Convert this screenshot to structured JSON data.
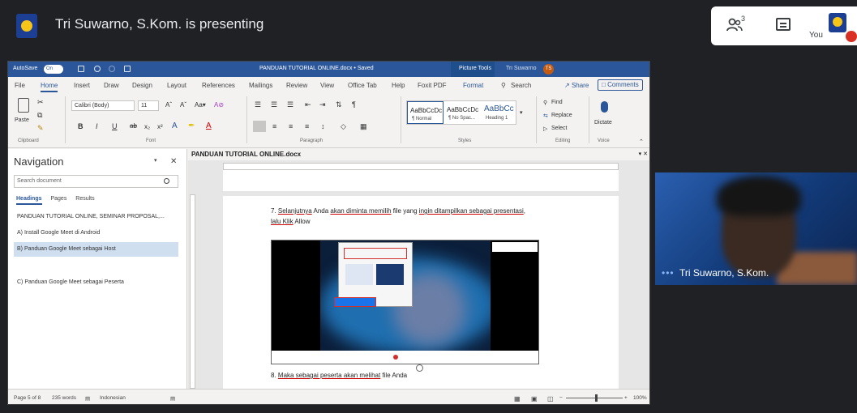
{
  "meet": {
    "presenting": "Tri Suwarno, S.Kom. is presenting",
    "people_count": "3",
    "you_label": "You",
    "participant_name": "Tri Suwarno, S.Kom.",
    "more_dots": "•••"
  },
  "word": {
    "titlebar": {
      "autosave": "AutoSave",
      "toggle": "On",
      "doc_title": "PANDUAN TUTORIAL ONLINE.docx • Saved",
      "picture_tools": "Picture Tools",
      "user": "Tri Suwarno",
      "initials": "TS"
    },
    "menu": {
      "file": "File",
      "home": "Home",
      "insert": "Insert",
      "draw": "Draw",
      "design": "Design",
      "layout": "Layout",
      "references": "References",
      "mailings": "Mailings",
      "review": "Review",
      "view": "View",
      "office_tab": "Office Tab",
      "help": "Help",
      "foxit": "Foxit PDF",
      "format": "Format",
      "search": "Search",
      "share": "Share",
      "comments": "Comments"
    },
    "ribbon": {
      "paste": "Paste",
      "font_name": "Calibri (Body)",
      "font_size": "11",
      "style1": "AaBbCcDc",
      "style1_name": "¶ Normal",
      "style2": "AaBbCcDc",
      "style2_name": "¶ No Spac...",
      "style3": "AaBbCc",
      "style3_name": "Heading 1",
      "find": "Find",
      "replace": "Replace",
      "select": "Select",
      "dictate": "Dictate",
      "groups": {
        "clipboard": "Clipboard",
        "font": "Font",
        "paragraph": "Paragraph",
        "styles": "Styles",
        "editing": "Editing",
        "voice": "Voice"
      }
    },
    "nav": {
      "title": "Navigation",
      "search_placeholder": "Search document",
      "tabs": [
        "Headings",
        "Pages",
        "Results"
      ],
      "items": [
        "PANDUAN TUTORIAL ONLINE, SEMINAR PROPOSAL,...",
        "A) Install Google Meet di Android",
        "B) Panduan Google Meet sebagai Host",
        "C) Panduan Google Meet sebagai Peserta"
      ]
    },
    "doc": {
      "tab_title": "PANDUAN TUTORIAL ONLINE.docx",
      "step7_a": "7. ",
      "step7_w1": "Selanjutnya",
      "step7_b": " Anda ",
      "step7_w2": "akan diminta memilih",
      "step7_c": " file yang ",
      "step7_w3": "ingin ditampilkan sebagai presentasi",
      "step7_d": ",",
      "step7_line2_w": "lalu Klik",
      "step7_line2_b": " Allow",
      "step8_a": "8. ",
      "step8_w1": "Maka sebagai peserta akan melihat",
      "step8_b": " file Anda"
    },
    "status": {
      "page": "Page 5 of 8",
      "words": "235 words",
      "language": "Indonesian",
      "zoom": "100%"
    }
  }
}
